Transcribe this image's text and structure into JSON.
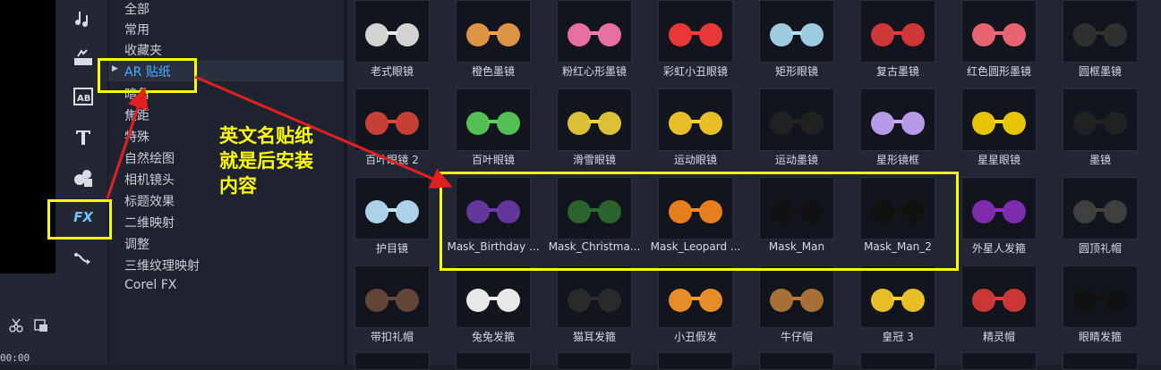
{
  "timecode": "00:00",
  "categories": [
    {
      "label": "全部"
    },
    {
      "label": "常用"
    },
    {
      "label": "收藏夹"
    },
    {
      "label": "AR 贴纸",
      "selected": true
    },
    {
      "label": "暗角"
    },
    {
      "label": "焦距"
    },
    {
      "label": "特殊"
    },
    {
      "label": "自然绘图"
    },
    {
      "label": "相机镜头"
    },
    {
      "label": "标题效果"
    },
    {
      "label": "二维映射"
    },
    {
      "label": "调整"
    },
    {
      "label": "三维纹理映射"
    },
    {
      "label": "Corel FX"
    }
  ],
  "toolbar_icons": [
    "audio-icon",
    "transition-icon",
    "title-ab-icon",
    "text-icon",
    "graphics-icon",
    "fx-icon",
    "motion-path-icon"
  ],
  "fx_label": "FX",
  "annotation": {
    "line1": "英文名贴纸",
    "line2": "就是后安装",
    "line3": "内容",
    "color": "#ffff00"
  },
  "rows": [
    [
      "老式眼镜",
      "橙色墨镜",
      "粉红心形墨镜",
      "彩虹小丑眼镜",
      "矩形眼镜",
      "复古墨镜",
      "红色圆形墨镜",
      "圆框墨镜"
    ],
    [
      "百叶眼镜 2",
      "百叶眼镜",
      "滑雪眼镜",
      "运动眼镜",
      "运动墨镜",
      "星形镜框",
      "星星眼镜",
      "墨镜"
    ],
    [
      "护目镜",
      "Mask_Birthday ...",
      "Mask_Christma...",
      "Mask_Leopard ...",
      "Mask_Man",
      "Mask_Man_2",
      "外星人发箍",
      "圆顶礼帽"
    ],
    [
      "带扣礼帽",
      "兔兔发箍",
      "猫耳发箍",
      "小丑假发",
      "牛仔帽",
      "皇冠 3",
      "精灵帽",
      "眼睛发箍"
    ]
  ]
}
